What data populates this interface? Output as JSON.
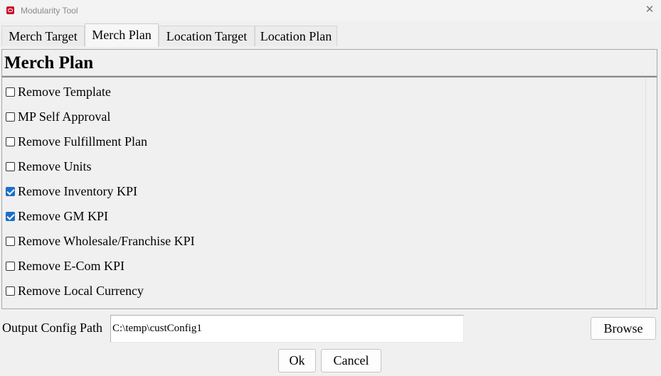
{
  "window": {
    "title": "Modularity Tool",
    "app_icon": "oracle-app-icon",
    "close_icon": "close-icon",
    "close_glyph": "✕"
  },
  "tabs": [
    {
      "label": "Merch Target",
      "active": false
    },
    {
      "label": "Merch Plan",
      "active": true
    },
    {
      "label": "Location Target",
      "active": false
    },
    {
      "label": "Location Plan",
      "active": false
    }
  ],
  "panel": {
    "title": "Merch Plan",
    "options": [
      {
        "label": "Remove Template",
        "checked": false
      },
      {
        "label": "MP Self Approval",
        "checked": false
      },
      {
        "label": "Remove Fulfillment Plan",
        "checked": false
      },
      {
        "label": "Remove Units",
        "checked": false
      },
      {
        "label": "Remove Inventory KPI",
        "checked": true
      },
      {
        "label": "Remove GM KPI",
        "checked": true
      },
      {
        "label": "Remove Wholesale/Franchise KPI",
        "checked": false
      },
      {
        "label": "Remove E-Com KPI",
        "checked": false
      },
      {
        "label": "Remove Local Currency",
        "checked": false
      }
    ]
  },
  "output": {
    "label": "Output Config Path",
    "value": "C:\\temp\\custConfig1",
    "browse_label": "Browse"
  },
  "footer": {
    "ok_label": "Ok",
    "cancel_label": "Cancel"
  },
  "colors": {
    "checkbox_checked": "#1a6fc9",
    "app_icon": "#c8102e"
  }
}
